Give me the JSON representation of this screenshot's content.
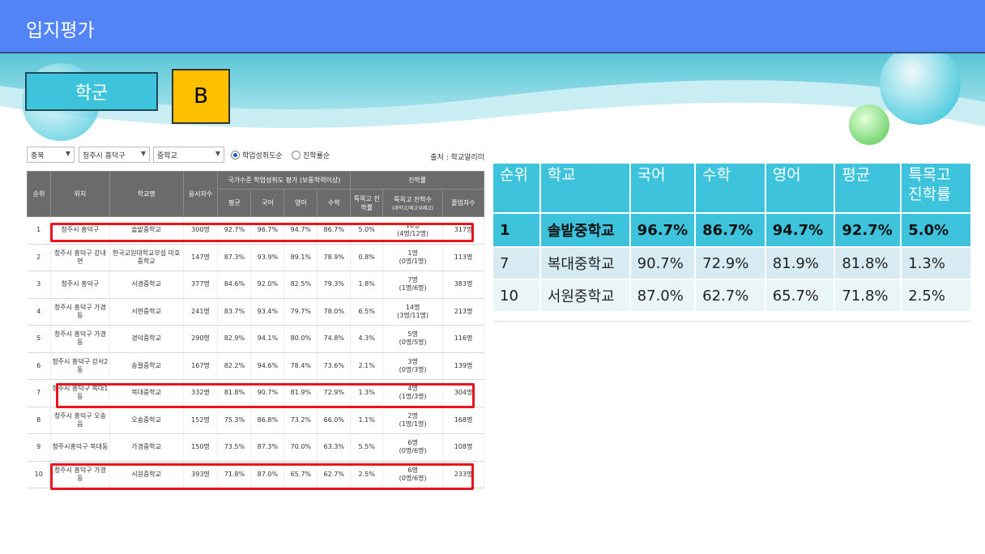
{
  "slide": {
    "title": "입지평가",
    "tag_label": "학군",
    "grade": "B"
  },
  "colors": {
    "title_bar": "#5384f5",
    "accent": "#3ec3dc",
    "grade_box": "#ffc000",
    "highlight": "#e8141e"
  },
  "source": {
    "filters": [
      "충북",
      "청주시 흥덕구",
      "중학교"
    ],
    "radios": [
      {
        "label": "학업성취도순",
        "selected": true
      },
      {
        "label": "진학률순",
        "selected": false
      }
    ],
    "note": "출처 : 학교알리미",
    "header": {
      "rank": "순위",
      "location": "위치",
      "school": "학교명",
      "applicants": "응시자수",
      "achievement_group": "국가수준 학업성취도 평가 (보통학력이상)",
      "avg": "평균",
      "korean": "국어",
      "english": "영어",
      "math": "수학",
      "advance_group": "진학률",
      "special_rate": "특목고 진학률",
      "special_count": "특목고 진학수",
      "special_count_sub": "(과학고/외고국제고)",
      "graduates": "졸업자수"
    },
    "rows": [
      {
        "rank": "1",
        "loc": "청주시 흥덕구",
        "school": "솔밭중학교",
        "n": "300명",
        "avg": "92.7%",
        "kor": "96.7%",
        "eng": "94.7%",
        "math": "86.7%",
        "rate": "5.0%",
        "cnt": "16명",
        "cnt_sub": "(4명/12명)",
        "grad": "317명"
      },
      {
        "rank": "2",
        "loc": "청주시 흥덕구 강내면",
        "school": "한국교원대학교부설 미호중학교",
        "n": "147명",
        "avg": "87.3%",
        "kor": "93.9%",
        "eng": "89.1%",
        "math": "78.9%",
        "rate": "0.8%",
        "cnt": "1명",
        "cnt_sub": "(0명/1명)",
        "grad": "113명"
      },
      {
        "rank": "3",
        "loc": "청주시 흥덕구",
        "school": "서경중학교",
        "n": "377명",
        "avg": "84.6%",
        "kor": "92.0%",
        "eng": "82.5%",
        "math": "79.3%",
        "rate": "1.8%",
        "cnt": "7명",
        "cnt_sub": "(1명/6명)",
        "grad": "383명"
      },
      {
        "rank": "4",
        "loc": "청주시 흥덕구 가경동",
        "school": "서현중학교",
        "n": "241명",
        "avg": "83.7%",
        "kor": "93.4%",
        "eng": "79.7%",
        "math": "78.0%",
        "rate": "6.5%",
        "cnt": "14명",
        "cnt_sub": "(3명/11명)",
        "grad": "213명"
      },
      {
        "rank": "5",
        "loc": "청주시 흥덕구 가경동",
        "school": "경덕중학교",
        "n": "290명",
        "avg": "82.9%",
        "kor": "94.1%",
        "eng": "80.0%",
        "math": "74.8%",
        "rate": "4.3%",
        "cnt": "5명",
        "cnt_sub": "(0명/5명)",
        "grad": "116명"
      },
      {
        "rank": "6",
        "loc": "청주시 흥덕구 강서2동",
        "school": "송절중학교",
        "n": "167명",
        "avg": "82.2%",
        "kor": "94.6%",
        "eng": "78.4%",
        "math": "73.6%",
        "rate": "2.1%",
        "cnt": "3명",
        "cnt_sub": "(0명/3명)",
        "grad": "139명"
      },
      {
        "rank": "7",
        "loc": "청주시 흥덕구 복대1동",
        "school": "복대중학교",
        "n": "332명",
        "avg": "81.8%",
        "kor": "90.7%",
        "eng": "81.9%",
        "math": "72.9%",
        "rate": "1.3%",
        "cnt": "4명",
        "cnt_sub": "(1명/3명)",
        "grad": "304명"
      },
      {
        "rank": "8",
        "loc": "청주시 흥덕구 오송읍",
        "school": "오송중학교",
        "n": "152명",
        "avg": "75.3%",
        "kor": "86.8%",
        "eng": "73.2%",
        "math": "66.0%",
        "rate": "1.1%",
        "cnt": "2명",
        "cnt_sub": "(1명/1명)",
        "grad": "168명"
      },
      {
        "rank": "9",
        "loc": "청주시흥덕구 복대동",
        "school": "가경중학교",
        "n": "150명",
        "avg": "73.5%",
        "kor": "87.3%",
        "eng": "70.0%",
        "math": "63.3%",
        "rate": "5.5%",
        "cnt": "6명",
        "cnt_sub": "(0명/6명)",
        "grad": "108명"
      },
      {
        "rank": "10",
        "loc": "청주시 흥덕구 가경동",
        "school": "서원중학교",
        "n": "393명",
        "avg": "71.8%",
        "kor": "87.0%",
        "eng": "65.7%",
        "math": "62.7%",
        "rate": "2.5%",
        "cnt": "6명",
        "cnt_sub": "(0명/6명)",
        "grad": "233명"
      }
    ]
  },
  "summary": {
    "headers": [
      "순위",
      "학교",
      "국어",
      "수학",
      "영어",
      "평균",
      "특목고 진학률"
    ],
    "rows": [
      [
        "1",
        "솔밭중학교",
        "96.7%",
        "86.7%",
        "94.7%",
        "92.7%",
        "5.0%"
      ],
      [
        "7",
        "복대중학교",
        "90.7%",
        "72.9%",
        "81.9%",
        "81.8%",
        "1.3%"
      ],
      [
        "10",
        "서원중학교",
        "87.0%",
        "62.7%",
        "65.7%",
        "71.8%",
        "2.5%"
      ]
    ]
  }
}
